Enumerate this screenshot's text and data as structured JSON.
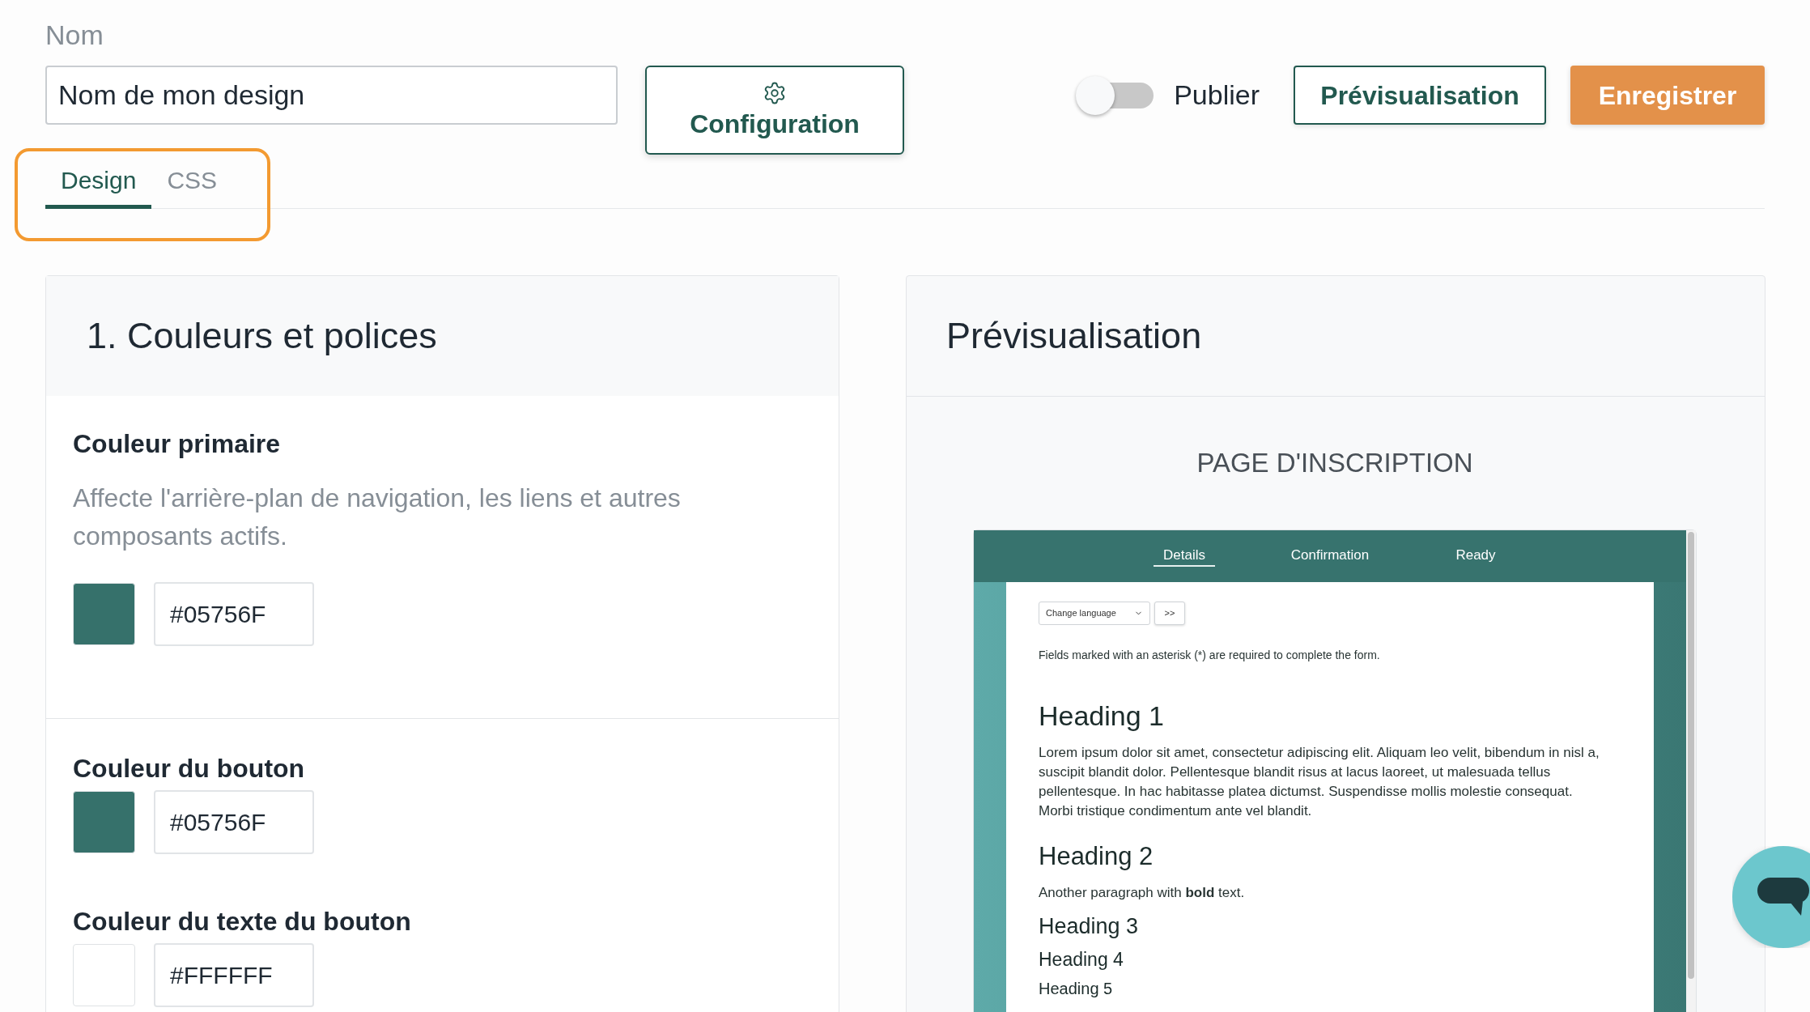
{
  "name_field": {
    "label": "Nom",
    "value": "Nom de mon design"
  },
  "configuration_button": {
    "label": "Configuration"
  },
  "publish_toggle": {
    "label": "Publier",
    "on": false
  },
  "actions": [
    {
      "kind": "outline",
      "label": "Prévisualisation"
    },
    {
      "kind": "primary",
      "label": "Enregistrer"
    }
  ],
  "tabs": [
    {
      "label": "Design",
      "selected": true
    },
    {
      "label": "CSS",
      "selected": false
    }
  ],
  "tabs_highlighted": true,
  "settings_panel": {
    "title": "1. Couleurs et polices",
    "sections": [
      {
        "fields": [
          {
            "label": "Couleur primaire",
            "description": "Affecte l'arrière-plan de navigation, les liens et autres composants actifs.",
            "value": "#05756F",
            "color": "#36716b"
          }
        ]
      },
      {
        "fields": [
          {
            "label": "Couleur du bouton",
            "value": "#05756F",
            "color": "#36716b"
          },
          {
            "label": "Couleur du texte du bouton",
            "value": "#FFFFFF",
            "color": "#ffffff"
          }
        ]
      }
    ]
  },
  "preview_panel": {
    "title": "Prévisualisation",
    "page_title": "PAGE D'INSCRIPTION",
    "steps": [
      {
        "label": "Details",
        "selected": true
      },
      {
        "label": "Confirmation",
        "selected": false
      },
      {
        "label": "Ready",
        "selected": false
      }
    ],
    "language_select": {
      "value": "Change language"
    },
    "go_button": ">>",
    "notice": "Fields marked with an asterisk (*) are required to complete the form.",
    "content": [
      {
        "kind": "h1",
        "text": "Heading 1"
      },
      {
        "kind": "p",
        "text": "Lorem ipsum dolor sit amet, consectetur adipiscing elit. Aliquam leo velit, bibendum in nisl a, suscipit blandit dolor. Pellentesque blandit risus at lacus laoreet, ut malesuada tellus pellentesque. In hac habitasse platea dictumst. Suspendisse mollis molestie consequat. Morbi tristique condimentum ante vel blandit."
      },
      {
        "kind": "h2",
        "text": "Heading 2"
      },
      {
        "kind": "p",
        "text": "Another paragraph with **bold** text."
      },
      {
        "kind": "h3",
        "text": "Heading 3"
      },
      {
        "kind": "h4",
        "text": "Heading 4"
      },
      {
        "kind": "h5",
        "text": "Heading 5"
      }
    ]
  }
}
